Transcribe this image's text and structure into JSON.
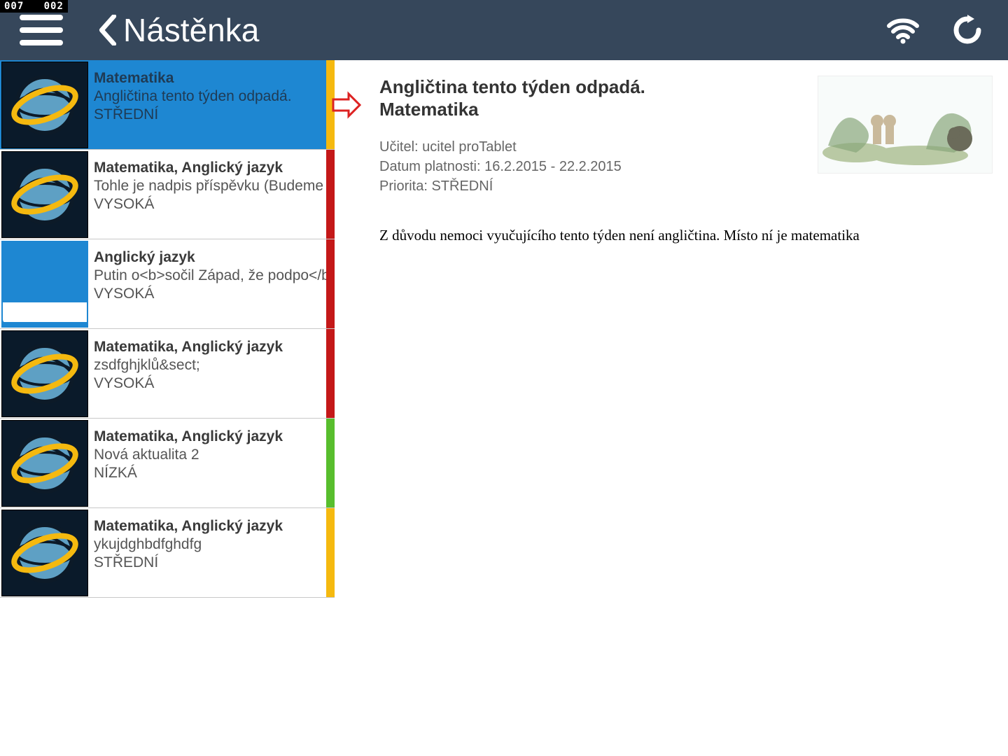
{
  "status": {
    "left": "007",
    "right": "002"
  },
  "header": {
    "title": "Nástěnka"
  },
  "priority_colors": {
    "STŘEDNÍ": "#f5b90f",
    "VYSOKÁ": "#c41818",
    "NÍZKÁ": "#58be2d"
  },
  "list": [
    {
      "title": "Matematika",
      "subtitle": "Angličtina tento týden odpadá.",
      "priority": "STŘEDNÍ",
      "stripe": "yellow",
      "selected": true,
      "icon": "globe"
    },
    {
      "title": "Matematika, Anglický jazyk",
      "subtitle": "Tohle je nadpis příspěvku (Budeme se",
      "priority": "VYSOKÁ",
      "stripe": "red",
      "selected": false,
      "icon": "globe"
    },
    {
      "title": "Anglický jazyk",
      "subtitle": "Putin o<b>sočil Západ, že podpo</b",
      "priority": "VYSOKÁ",
      "stripe": "red",
      "selected": false,
      "icon": "book"
    },
    {
      "title": "Matematika, Anglický jazyk",
      "subtitle": "zsdfghjklů&sect;",
      "priority": "VYSOKÁ",
      "stripe": "red",
      "selected": false,
      "icon": "globe"
    },
    {
      "title": "Matematika, Anglický jazyk",
      "subtitle": "Nová aktualita 2",
      "priority": "NÍZKÁ",
      "stripe": "green",
      "selected": false,
      "icon": "globe"
    },
    {
      "title": "Matematika, Anglický jazyk",
      "subtitle": "ykujdghbdfghdfg",
      "priority": "STŘEDNÍ",
      "stripe": "yellow",
      "selected": false,
      "icon": "globe"
    }
  ],
  "detail": {
    "headline": "Angličtina tento týden odpadá.",
    "subject": "Matematika",
    "teacher_label": "Učitel:",
    "teacher_value": "ucitel proTablet",
    "validity_label": "Datum platnosti:",
    "validity_value": "16.2.2015 - 22.2.2015",
    "priority_label": "Priorita:",
    "priority_value": "STŘEDNÍ",
    "body": "Z důvodu nemoci vyučujícího tento týden není angličtina. Místo ní je matematika"
  }
}
